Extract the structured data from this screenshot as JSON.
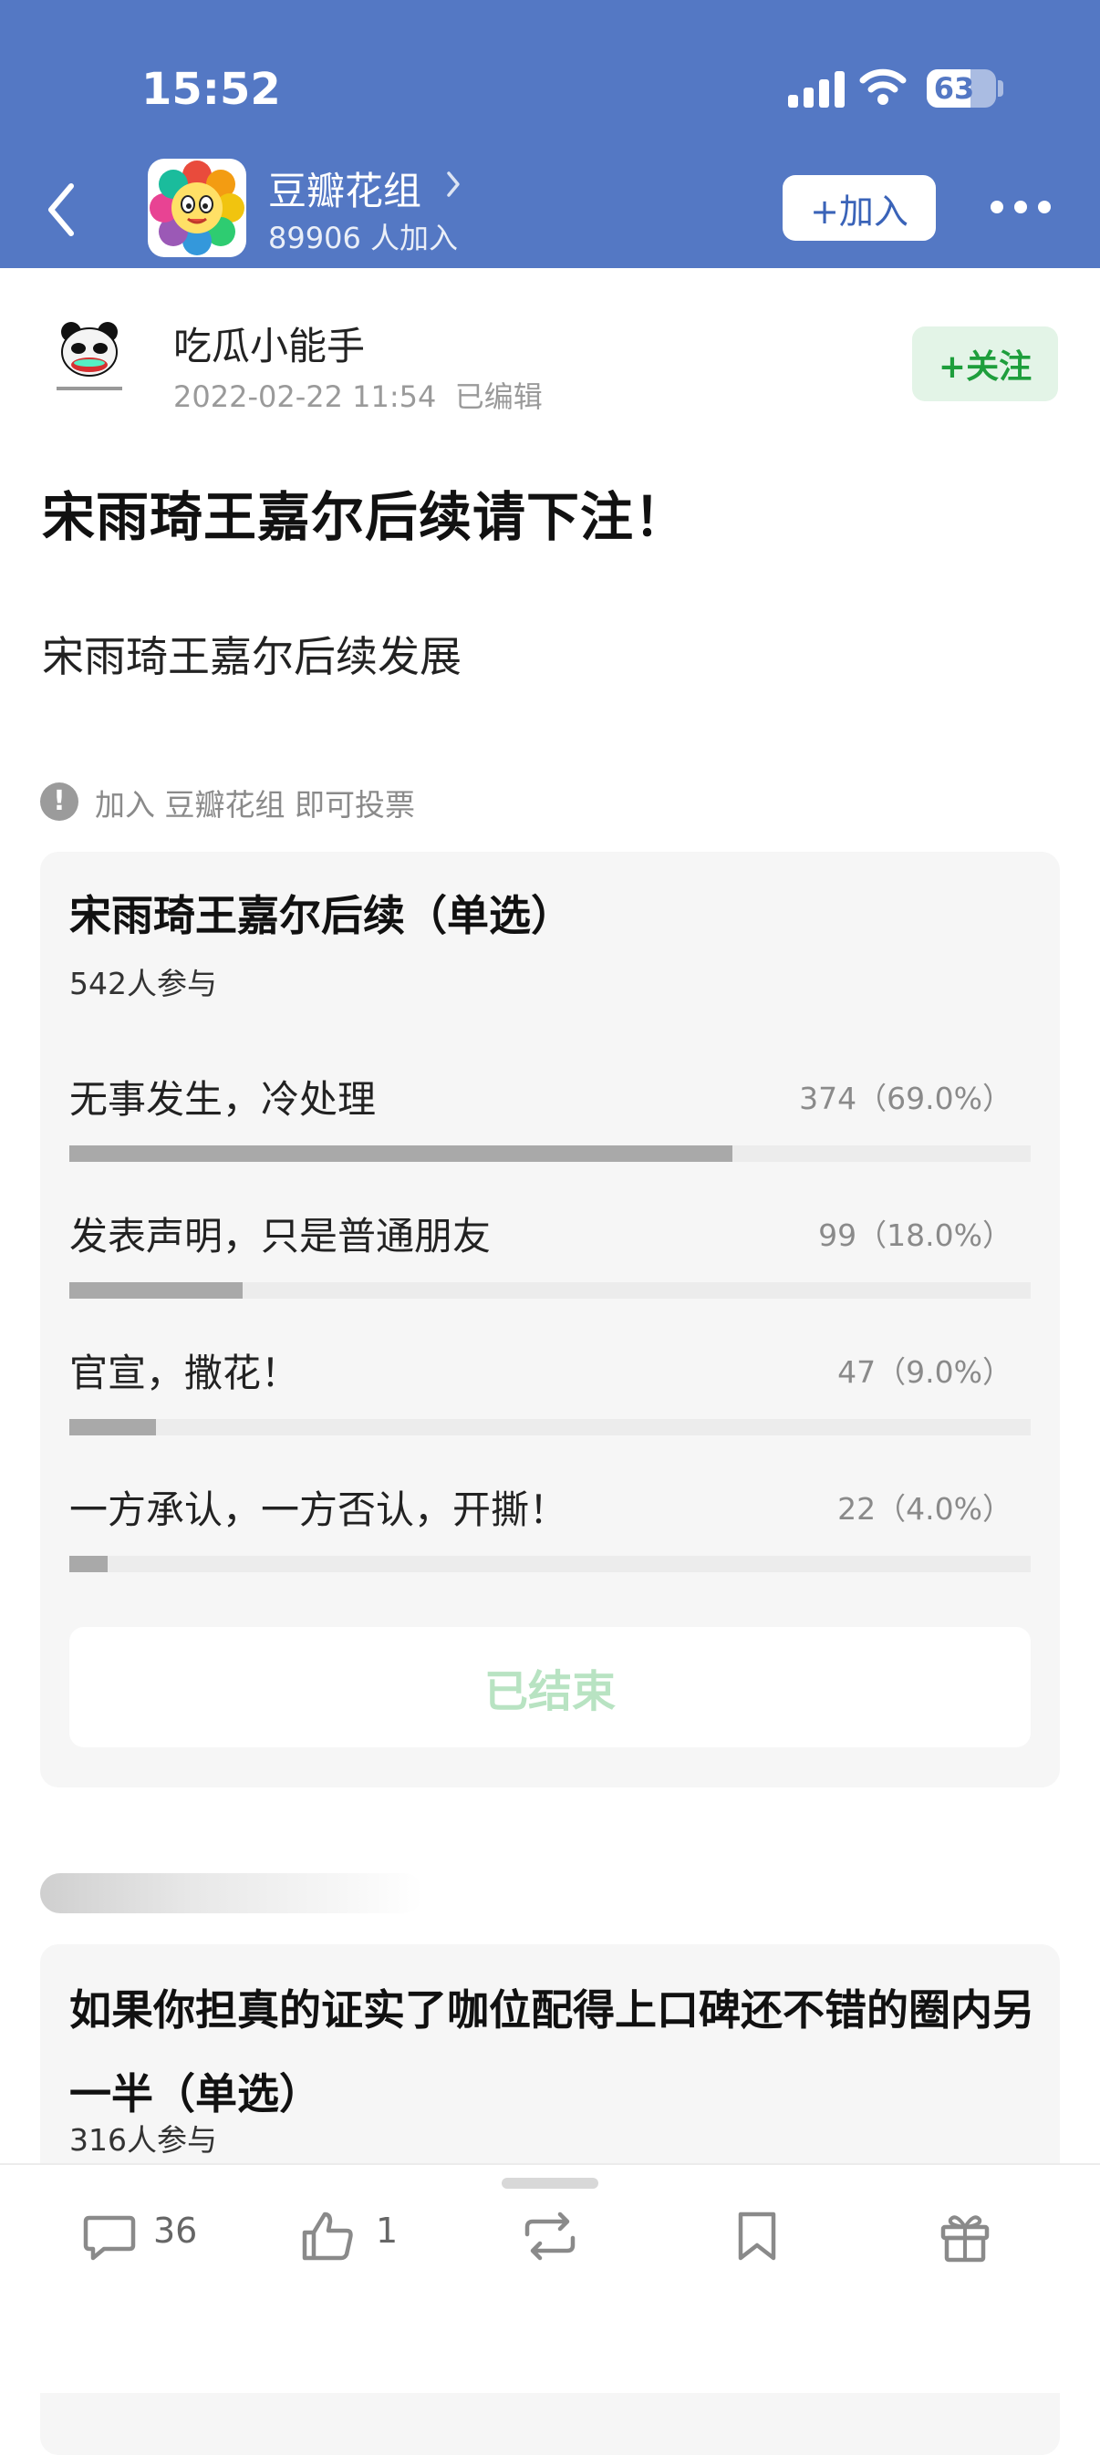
{
  "status_bar": {
    "time": "15:52",
    "battery": "63",
    "battery_level": 0.63
  },
  "header": {
    "group_name": "豆瓣花组",
    "members": "89906 人加入",
    "join_label": "+加入",
    "icons": {
      "back": "back-arrow-icon",
      "more": "more-dots-icon",
      "chevron": "chevron-right-icon"
    }
  },
  "post": {
    "author": "吃瓜小能手",
    "time": "2022-02-22 11:54",
    "edited": "已编辑",
    "follow_label": "+关注",
    "title": "宋雨琦王嘉尔后续请下注！",
    "body": "宋雨琦王嘉尔后续发展",
    "notice": "加入 豆瓣花组 即可投票"
  },
  "poll": {
    "title": "宋雨琦王嘉尔后续（单选）",
    "participants": "542人参与",
    "options": [
      {
        "label": "无事发生，冷处理",
        "stat": "374（69.0%）",
        "fraction": 0.69
      },
      {
        "label": "发表声明，只是普通朋友",
        "stat": "99（18.0%）",
        "fraction": 0.18
      },
      {
        "label": "官宣，撒花！",
        "stat": "47（9.0%）",
        "fraction": 0.09
      },
      {
        "label": "一方承认，一方否认，开撕！",
        "stat": "22（4.0%）",
        "fraction": 0.04
      }
    ],
    "ended_label": "已结束"
  },
  "poll2": {
    "title": "如果你担真的证实了咖位配得上口碑还不错的圈内另一半（单选）",
    "participants": "316人参与"
  },
  "bottom_bar": {
    "comment_count": "36",
    "like_count": "1",
    "icons": [
      "comment-icon",
      "like-icon",
      "repost-icon",
      "bookmark-icon",
      "gift-icon"
    ]
  },
  "colors": {
    "header": "#5478c4",
    "follow": "#1e9e3c",
    "ended": "#b8e3c2"
  }
}
